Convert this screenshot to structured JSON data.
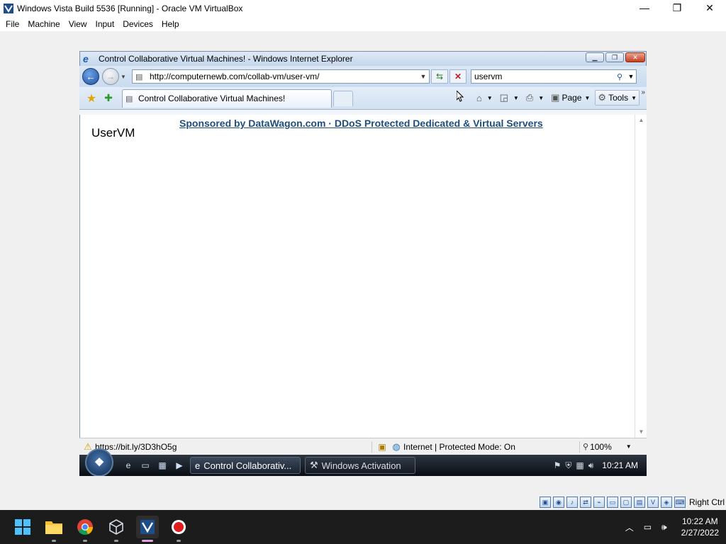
{
  "vbox": {
    "title": "Windows Vista Build 5536 [Running] - Oracle VM VirtualBox",
    "menu": [
      "File",
      "Machine",
      "View",
      "Input",
      "Devices",
      "Help"
    ],
    "window_controls": {
      "minimize": "—",
      "maximize": "❐",
      "close": "✕"
    },
    "status": {
      "host_key": "Right Ctrl"
    }
  },
  "ie": {
    "title": "Control Collaborative Virtual Machines! - Windows Internet Explorer",
    "address": "http://computernewb.com/collab-vm/user-vm/",
    "search_value": "uservm",
    "tab_title": "Control Collaborative Virtual Machines!",
    "command_bar": {
      "page": "Page",
      "tools": "Tools"
    },
    "page": {
      "sponsor": "Sponsored by DataWagon.com · DDoS Protected Dedicated & Virtual Servers",
      "heading": "UserVM"
    },
    "status": {
      "url": "https://bit.ly/3D3hO5g",
      "zone": "Internet | Protected Mode: On",
      "zoom": "100%"
    }
  },
  "vista_taskbar": {
    "orb_label": "❖",
    "buttons": [
      {
        "label": "Control Collaborativ..."
      },
      {
        "label": "Windows Activation"
      }
    ],
    "clock": "10:21 AM"
  },
  "host": {
    "clock_time": "10:22 AM",
    "clock_date": "2/27/2022"
  },
  "colors": {
    "ie_link": "#1d4e7e",
    "host_taskbar": "#1c1c1c"
  }
}
